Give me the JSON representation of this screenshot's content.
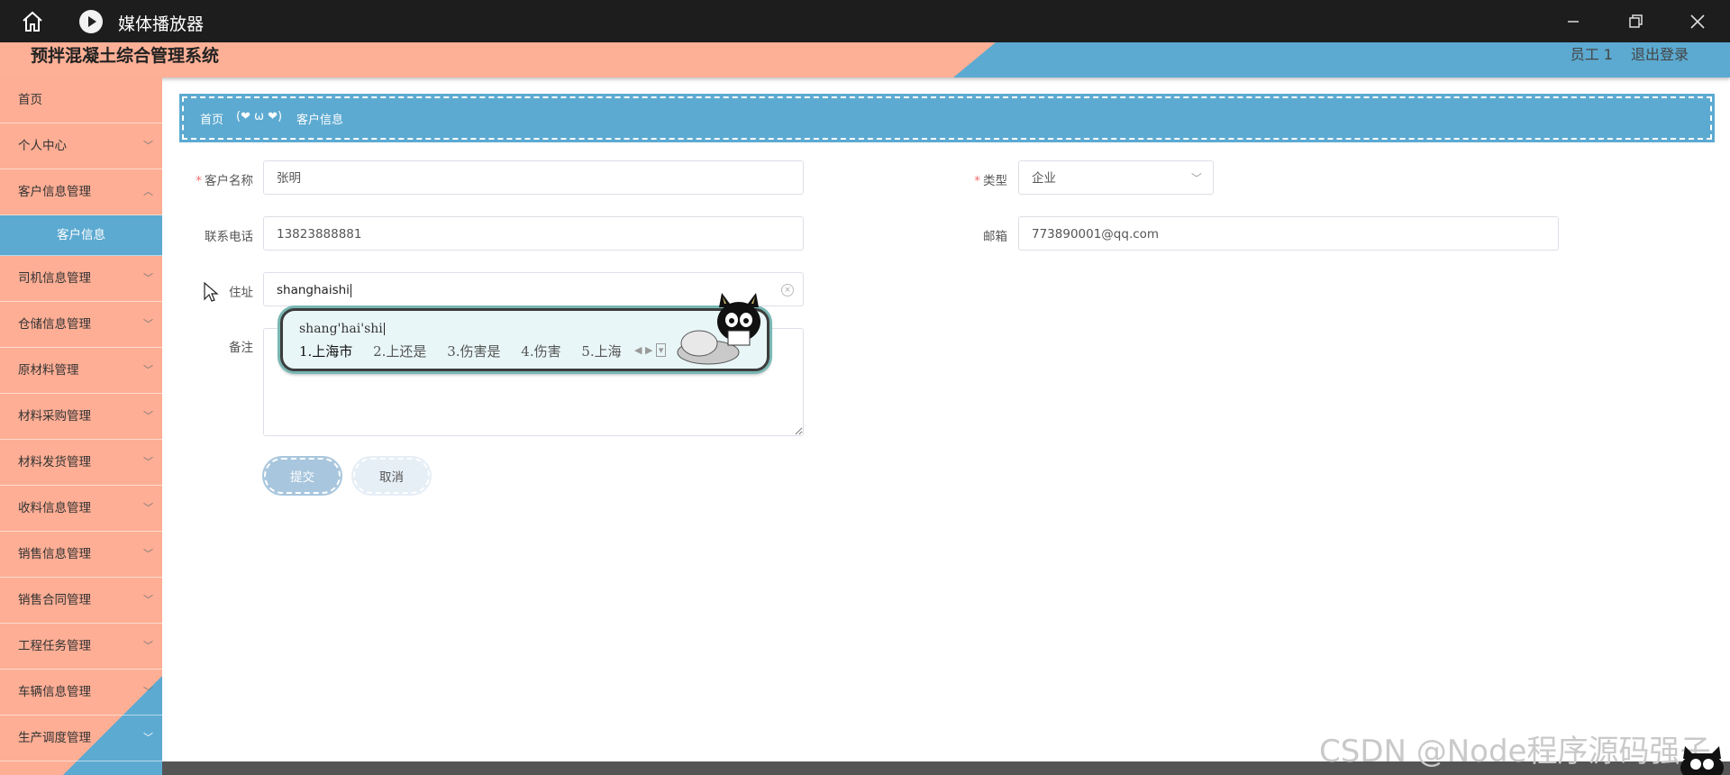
{
  "window": {
    "app_name": "媒体播放器",
    "icons": [
      "home-icon",
      "play-icon",
      "minimize-icon",
      "restore-icon",
      "close-icon"
    ]
  },
  "header": {
    "title": "预拌混凝土综合管理系统",
    "user": "员工 1",
    "logout": "退出登录"
  },
  "sidebar": {
    "items": [
      {
        "label": "首页",
        "chevron": false
      },
      {
        "label": "个人中心",
        "chevron": true
      },
      {
        "label": "客户信息管理",
        "chevron": true
      },
      {
        "label": "客户信息",
        "sub": true
      },
      {
        "label": "司机信息管理",
        "chevron": true
      },
      {
        "label": "仓储信息管理",
        "chevron": true
      },
      {
        "label": "原材料管理",
        "chevron": true
      },
      {
        "label": "材料采购管理",
        "chevron": true
      },
      {
        "label": "材料发货管理",
        "chevron": true
      },
      {
        "label": "收料信息管理",
        "chevron": true
      },
      {
        "label": "销售信息管理",
        "chevron": true
      },
      {
        "label": "销售合同管理",
        "chevron": true
      },
      {
        "label": "工程任务管理",
        "chevron": true
      },
      {
        "label": "车辆信息管理",
        "chevron": true
      },
      {
        "label": "生产调度管理",
        "chevron": true
      }
    ]
  },
  "breadcrumb": {
    "home": "首页",
    "separator": "(❤ ω ❤)",
    "current": "客户信息"
  },
  "form": {
    "customer_name": {
      "label": "客户名称",
      "value": "张明",
      "required": true
    },
    "type": {
      "label": "类型",
      "value": "企业",
      "required": true
    },
    "phone": {
      "label": "联系电话",
      "value": "13823888881"
    },
    "email": {
      "label": "邮箱",
      "value": "773890001@qq.com"
    },
    "address": {
      "label": "住址",
      "value": "shanghaishi"
    },
    "remarks": {
      "label": "备注",
      "value": ""
    },
    "submit": "提交",
    "cancel": "取消"
  },
  "ime": {
    "composition": "shang'hai'shi",
    "candidates": [
      "1.上海市",
      "2.上还是",
      "3.伤害是",
      "4.伤害",
      "5.上海"
    ]
  },
  "watermark": "CSDN @Node程序源码强子",
  "colors": {
    "salmon": "#fdb096",
    "blue": "#5caad1",
    "titlebar": "#1d1d1d",
    "required": "#f56c6c"
  }
}
